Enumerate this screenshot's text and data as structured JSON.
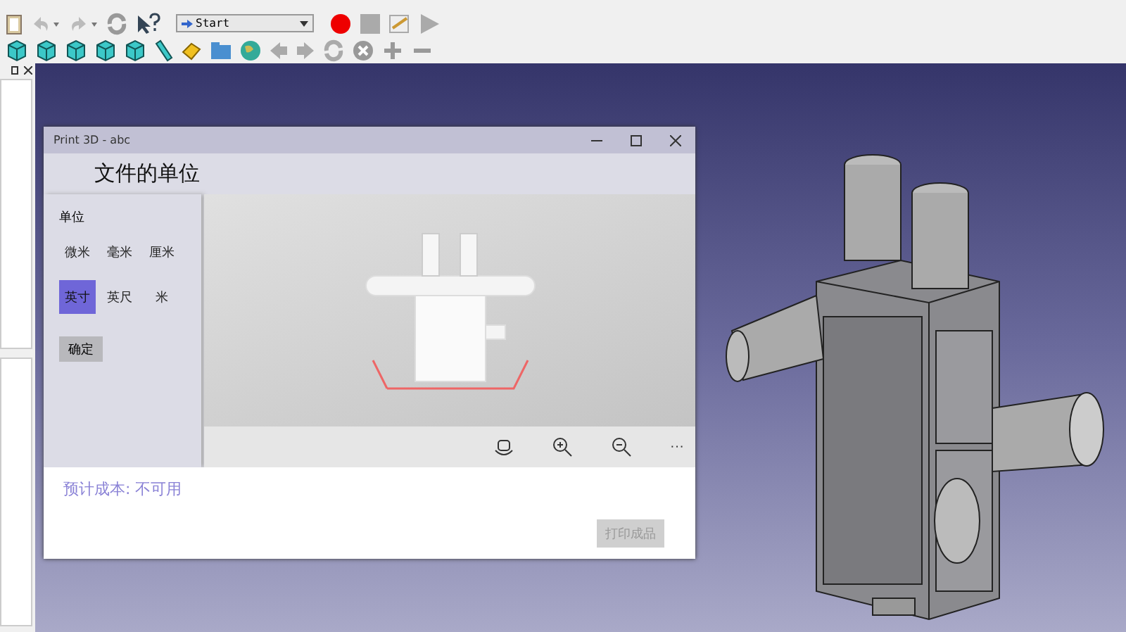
{
  "toolbar": {
    "macro_dropdown": {
      "value": "Start"
    }
  },
  "dialog": {
    "title": "Print 3D - abc",
    "heading": "文件的单位",
    "units_label": "单位",
    "units": [
      {
        "label": "微米",
        "selected": false
      },
      {
        "label": "毫米",
        "selected": false
      },
      {
        "label": "厘米",
        "selected": false
      },
      {
        "label": "英寸",
        "selected": true
      },
      {
        "label": "英尺",
        "selected": false
      },
      {
        "label": "米",
        "selected": false
      }
    ],
    "confirm_button": "确定",
    "more_button": "···",
    "cost": "预计成本: 不可用",
    "print_button": {
      "label": "打印成品",
      "disabled": true
    }
  }
}
